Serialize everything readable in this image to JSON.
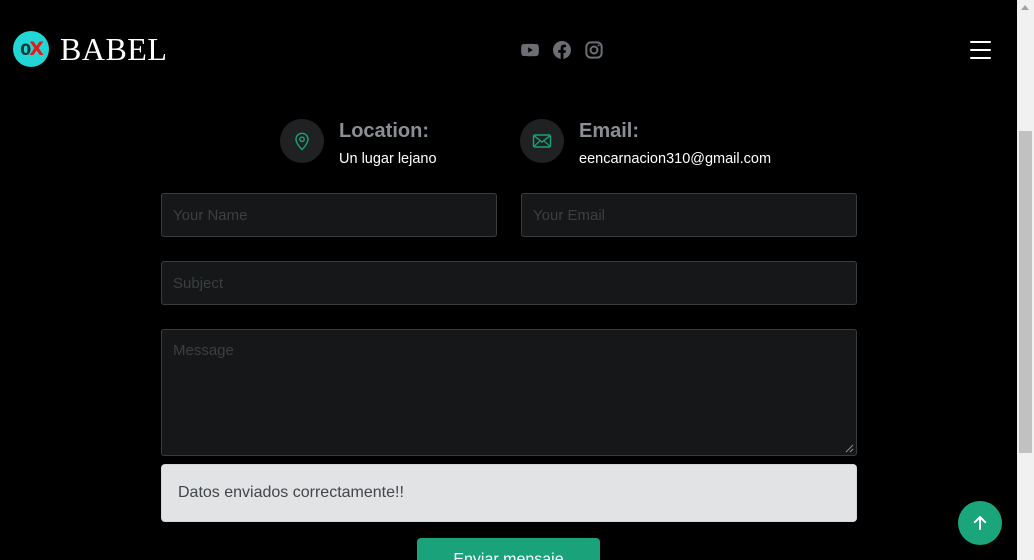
{
  "brand": {
    "badge_o": "0",
    "badge_x": "X",
    "name": "BABEL"
  },
  "socials": [
    "youtube-icon",
    "facebook-icon",
    "instagram-icon"
  ],
  "menu_icon": "hamburger-menu-icon",
  "contact": {
    "location": {
      "title": "Location:",
      "value": "Un lugar lejano",
      "icon": "map-pin-icon"
    },
    "email": {
      "title": "Email:",
      "value": "eencarnacion310@gmail.com",
      "icon": "envelope-icon"
    }
  },
  "form": {
    "name_placeholder": "Your Name",
    "email_placeholder": "Your Email",
    "subject_placeholder": "Subject",
    "message_placeholder": "Message",
    "success_message": "Datos enviados correctamente!!",
    "submit_label": "Enviar mensaje"
  },
  "back_to_top_icon": "arrow-up-icon",
  "colors": {
    "background": "#000000",
    "accent": "#1aa37a",
    "field_bg": "#151718",
    "alert_bg": "#e2e3e5"
  }
}
